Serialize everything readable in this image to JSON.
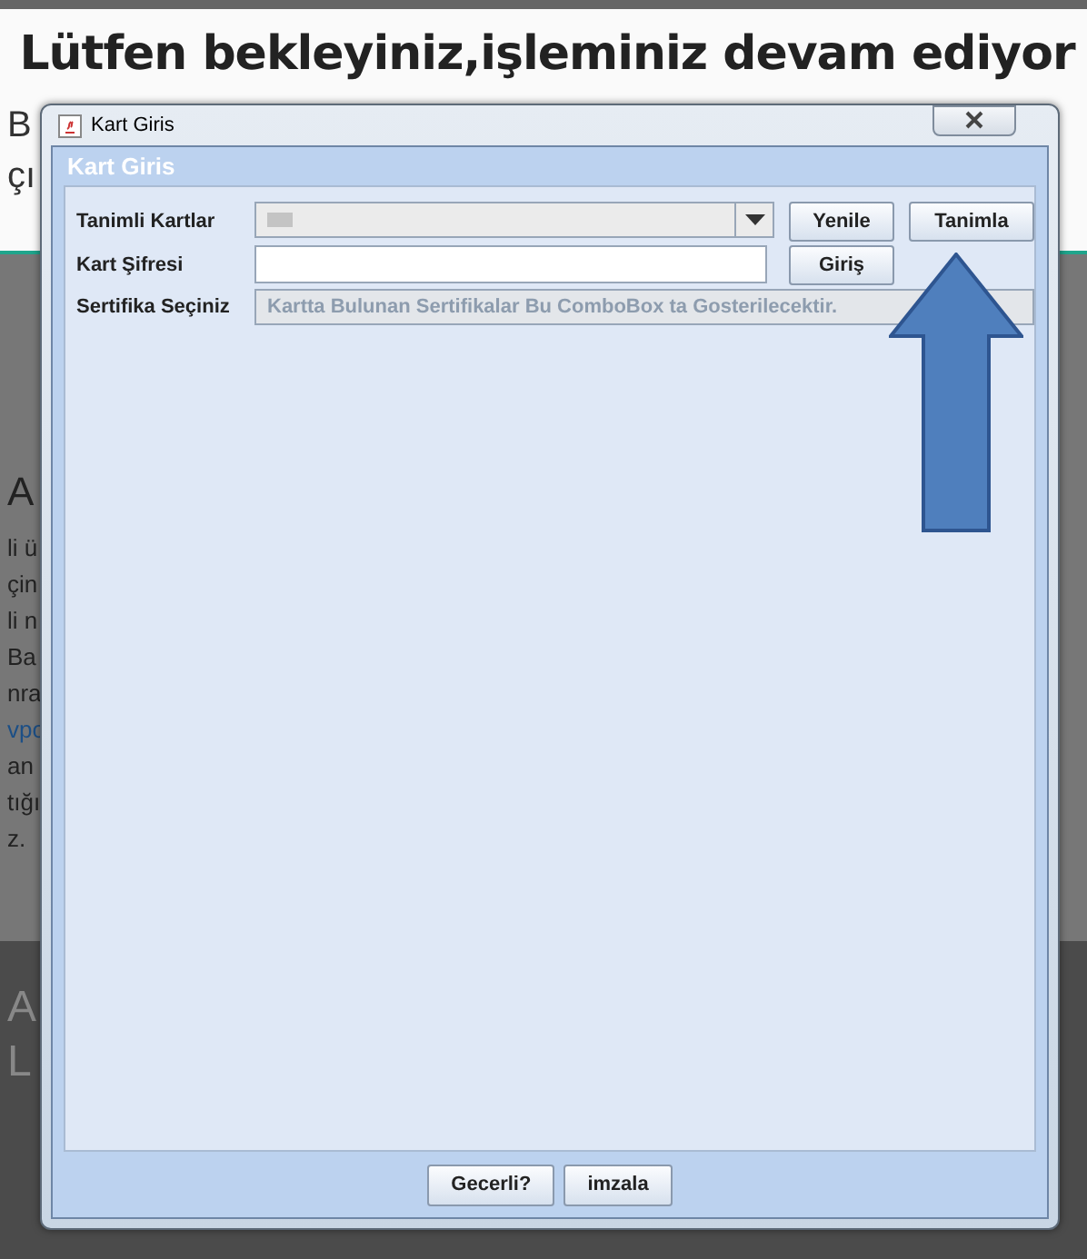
{
  "page": {
    "heading": "Lütfen bekleyiniz,işleminiz devam ediyor",
    "intro_fragments": [
      "B",
      "çı"
    ],
    "section_title": "A",
    "body_fragments": [
      {
        "text": "li ü",
        "kind": "text"
      },
      {
        "text": "çin",
        "kind": "text"
      },
      {
        "text": "li n",
        "kind": "text"
      },
      {
        "text": "Ba",
        "kind": "text"
      },
      {
        "text": "nra",
        "kind": "text"
      },
      {
        "text": "vpo",
        "kind": "link"
      },
      {
        "text": "an",
        "kind": "text"
      },
      {
        "text": "tığı",
        "kind": "text"
      },
      {
        "text": "z.",
        "kind": "text"
      }
    ],
    "footer_fragments": [
      "A",
      "L"
    ]
  },
  "dialog": {
    "title": "Kart Giris",
    "header": "Kart Giris",
    "rows": [
      {
        "label": "Tanimli Kartlar",
        "kind": "combo",
        "disabled": false,
        "buttons": [
          "Yenile",
          "Tanimla"
        ]
      },
      {
        "label": "Kart Şifresi",
        "kind": "password",
        "disabled": false,
        "buttons": [
          "Giriş"
        ]
      },
      {
        "label": "Sertifika Seçiniz",
        "kind": "combo",
        "disabled": true,
        "placeholder": "Kartta Bulunan Sertifikalar Bu ComboBox ta Gosterilecektir.",
        "buttons": []
      }
    ],
    "buttons": [
      "Gecerli?",
      "imzala"
    ]
  }
}
